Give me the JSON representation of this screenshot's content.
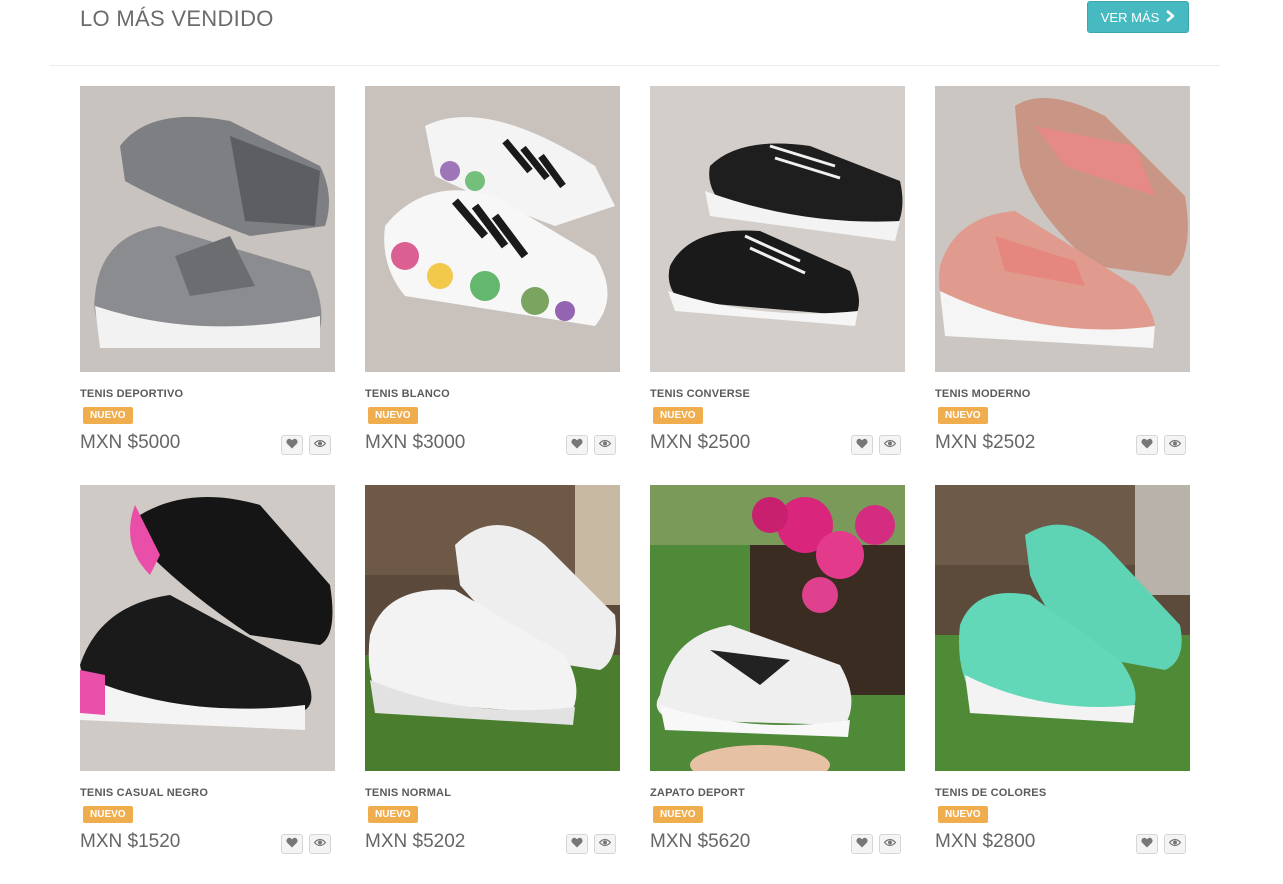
{
  "section": {
    "title": "LO MÁS VENDIDO",
    "more_label": "VER MÁS"
  },
  "products": [
    {
      "name": "TENIS DEPORTIVO",
      "badge": "NUEVO",
      "price": "MXN $5000",
      "photo": "grey-slip-on-sneakers-on-fur-rug"
    },
    {
      "name": "TENIS BLANCO",
      "badge": "NUEVO",
      "price": "MXN $3000",
      "photo": "white-striped-sneakers-with-paint-splatter"
    },
    {
      "name": "TENIS CONVERSE",
      "badge": "NUEVO",
      "price": "MXN $2500",
      "photo": "black-canvas-sneakers-on-fur-rug"
    },
    {
      "name": "TENIS MODERNO",
      "badge": "NUEVO",
      "price": "MXN $2502",
      "photo": "pink-mesh-slip-on-sneakers"
    },
    {
      "name": "TENIS CASUAL NEGRO",
      "badge": "NUEVO",
      "price": "MXN $1520",
      "photo": "black-pink-slip-on-sneakers"
    },
    {
      "name": "TENIS NORMAL",
      "badge": "NUEVO",
      "price": "MXN $5202",
      "photo": "white-leather-sneakers-on-grass"
    },
    {
      "name": "ZAPATO DEPORT",
      "badge": "NUEVO",
      "price": "MXN $5620",
      "photo": "white-knit-running-shoe-with-flowers"
    },
    {
      "name": "TENIS DE COLORES",
      "badge": "NUEVO",
      "price": "MXN $2800",
      "photo": "mint-green-sneakers-on-grass"
    }
  ],
  "colors": {
    "accent": "#47bac1",
    "badge": "#f0ad4e"
  },
  "icons": {
    "more": "chevron-right-icon",
    "favorite": "heart-icon",
    "view": "eye-icon"
  }
}
